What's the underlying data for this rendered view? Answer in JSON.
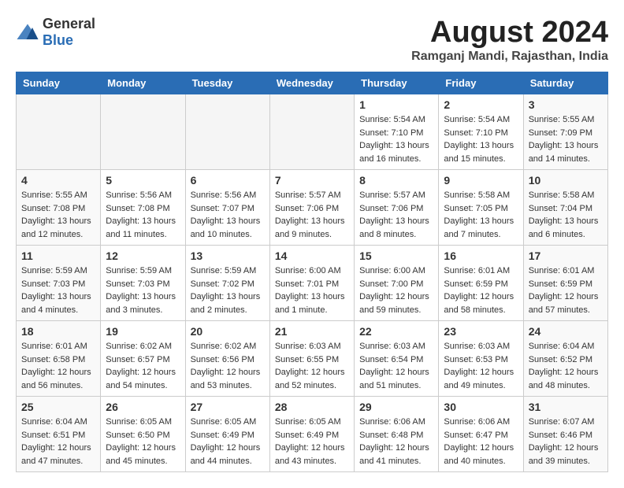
{
  "header": {
    "logo_general": "General",
    "logo_blue": "Blue",
    "month_year": "August 2024",
    "location": "Ramganj Mandi, Rajasthan, India"
  },
  "weekdays": [
    "Sunday",
    "Monday",
    "Tuesday",
    "Wednesday",
    "Thursday",
    "Friday",
    "Saturday"
  ],
  "weeks": [
    [
      {
        "day": "",
        "detail": ""
      },
      {
        "day": "",
        "detail": ""
      },
      {
        "day": "",
        "detail": ""
      },
      {
        "day": "",
        "detail": ""
      },
      {
        "day": "1",
        "detail": "Sunrise: 5:54 AM\nSunset: 7:10 PM\nDaylight: 13 hours\nand 16 minutes."
      },
      {
        "day": "2",
        "detail": "Sunrise: 5:54 AM\nSunset: 7:10 PM\nDaylight: 13 hours\nand 15 minutes."
      },
      {
        "day": "3",
        "detail": "Sunrise: 5:55 AM\nSunset: 7:09 PM\nDaylight: 13 hours\nand 14 minutes."
      }
    ],
    [
      {
        "day": "4",
        "detail": "Sunrise: 5:55 AM\nSunset: 7:08 PM\nDaylight: 13 hours\nand 12 minutes."
      },
      {
        "day": "5",
        "detail": "Sunrise: 5:56 AM\nSunset: 7:08 PM\nDaylight: 13 hours\nand 11 minutes."
      },
      {
        "day": "6",
        "detail": "Sunrise: 5:56 AM\nSunset: 7:07 PM\nDaylight: 13 hours\nand 10 minutes."
      },
      {
        "day": "7",
        "detail": "Sunrise: 5:57 AM\nSunset: 7:06 PM\nDaylight: 13 hours\nand 9 minutes."
      },
      {
        "day": "8",
        "detail": "Sunrise: 5:57 AM\nSunset: 7:06 PM\nDaylight: 13 hours\nand 8 minutes."
      },
      {
        "day": "9",
        "detail": "Sunrise: 5:58 AM\nSunset: 7:05 PM\nDaylight: 13 hours\nand 7 minutes."
      },
      {
        "day": "10",
        "detail": "Sunrise: 5:58 AM\nSunset: 7:04 PM\nDaylight: 13 hours\nand 6 minutes."
      }
    ],
    [
      {
        "day": "11",
        "detail": "Sunrise: 5:59 AM\nSunset: 7:03 PM\nDaylight: 13 hours\nand 4 minutes."
      },
      {
        "day": "12",
        "detail": "Sunrise: 5:59 AM\nSunset: 7:03 PM\nDaylight: 13 hours\nand 3 minutes."
      },
      {
        "day": "13",
        "detail": "Sunrise: 5:59 AM\nSunset: 7:02 PM\nDaylight: 13 hours\nand 2 minutes."
      },
      {
        "day": "14",
        "detail": "Sunrise: 6:00 AM\nSunset: 7:01 PM\nDaylight: 13 hours\nand 1 minute."
      },
      {
        "day": "15",
        "detail": "Sunrise: 6:00 AM\nSunset: 7:00 PM\nDaylight: 12 hours\nand 59 minutes."
      },
      {
        "day": "16",
        "detail": "Sunrise: 6:01 AM\nSunset: 6:59 PM\nDaylight: 12 hours\nand 58 minutes."
      },
      {
        "day": "17",
        "detail": "Sunrise: 6:01 AM\nSunset: 6:59 PM\nDaylight: 12 hours\nand 57 minutes."
      }
    ],
    [
      {
        "day": "18",
        "detail": "Sunrise: 6:01 AM\nSunset: 6:58 PM\nDaylight: 12 hours\nand 56 minutes."
      },
      {
        "day": "19",
        "detail": "Sunrise: 6:02 AM\nSunset: 6:57 PM\nDaylight: 12 hours\nand 54 minutes."
      },
      {
        "day": "20",
        "detail": "Sunrise: 6:02 AM\nSunset: 6:56 PM\nDaylight: 12 hours\nand 53 minutes."
      },
      {
        "day": "21",
        "detail": "Sunrise: 6:03 AM\nSunset: 6:55 PM\nDaylight: 12 hours\nand 52 minutes."
      },
      {
        "day": "22",
        "detail": "Sunrise: 6:03 AM\nSunset: 6:54 PM\nDaylight: 12 hours\nand 51 minutes."
      },
      {
        "day": "23",
        "detail": "Sunrise: 6:03 AM\nSunset: 6:53 PM\nDaylight: 12 hours\nand 49 minutes."
      },
      {
        "day": "24",
        "detail": "Sunrise: 6:04 AM\nSunset: 6:52 PM\nDaylight: 12 hours\nand 48 minutes."
      }
    ],
    [
      {
        "day": "25",
        "detail": "Sunrise: 6:04 AM\nSunset: 6:51 PM\nDaylight: 12 hours\nand 47 minutes."
      },
      {
        "day": "26",
        "detail": "Sunrise: 6:05 AM\nSunset: 6:50 PM\nDaylight: 12 hours\nand 45 minutes."
      },
      {
        "day": "27",
        "detail": "Sunrise: 6:05 AM\nSunset: 6:49 PM\nDaylight: 12 hours\nand 44 minutes."
      },
      {
        "day": "28",
        "detail": "Sunrise: 6:05 AM\nSunset: 6:49 PM\nDaylight: 12 hours\nand 43 minutes."
      },
      {
        "day": "29",
        "detail": "Sunrise: 6:06 AM\nSunset: 6:48 PM\nDaylight: 12 hours\nand 41 minutes."
      },
      {
        "day": "30",
        "detail": "Sunrise: 6:06 AM\nSunset: 6:47 PM\nDaylight: 12 hours\nand 40 minutes."
      },
      {
        "day": "31",
        "detail": "Sunrise: 6:07 AM\nSunset: 6:46 PM\nDaylight: 12 hours\nand 39 minutes."
      }
    ]
  ]
}
